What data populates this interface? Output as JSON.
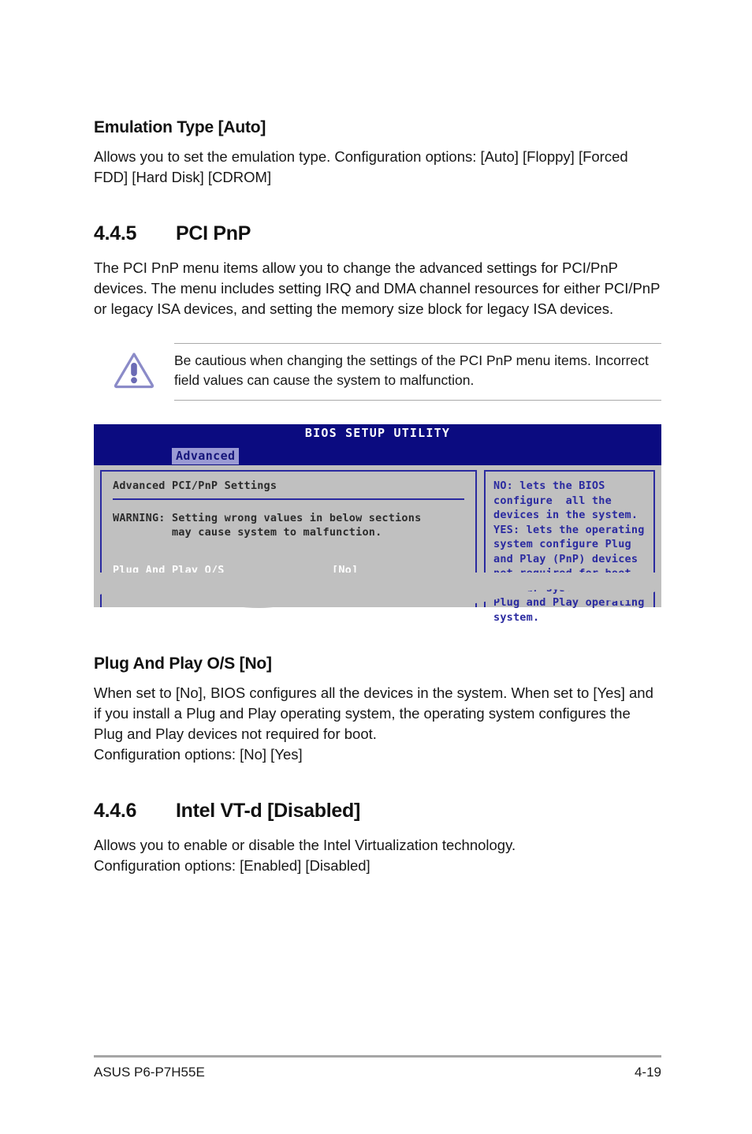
{
  "page": {
    "footer_left": "ASUS P6-P7H55E",
    "footer_right": "4-19"
  },
  "emulation": {
    "heading": "Emulation Type [Auto]",
    "body": "Allows you to set the emulation type. Configuration options: [Auto] [Floppy] [Forced FDD] [Hard Disk] [CDROM]"
  },
  "section_445": {
    "number": "4.4.5",
    "title": "PCI PnP",
    "body": "The PCI PnP menu items allow you to change the advanced settings for PCI/PnP devices. The menu includes setting IRQ and DMA channel resources for either PCI/PnP or legacy ISA devices, and setting the memory size block for legacy ISA devices."
  },
  "caution": {
    "icon": "warning-triangle-icon",
    "text": "Be cautious when changing the settings of the PCI PnP menu items. Incorrect field values can cause the system to malfunction."
  },
  "bios": {
    "title": "BIOS SETUP UTILITY",
    "active_tab": "Advanced",
    "left_panel": {
      "header": "Advanced PCI/PnP Settings",
      "warning_line1": "WARNING: Setting wrong values in below sections",
      "warning_line2": "         may cause system to malfunction.",
      "item_label": "Plug And Play O/S",
      "item_value": "[No]"
    },
    "help_panel": "NO: lets the BIOS\nconfigure  all the\ndevices in the system.\nYES: lets the operating\nsystem configure Plug\nand Play (PnP) devices\nnot required for boot\nif your system has a\nPlug and Play operating\nsystem.",
    "colors": {
      "titlebar": "#0b0b80",
      "panel_bg": "#c0c0c0",
      "border": "#2a2aa0",
      "tab_bg": "#9a9ad4",
      "help_text": "#2a2aa0"
    }
  },
  "pnp_os": {
    "heading": "Plug And Play O/S [No]",
    "body": "When set to [No], BIOS configures all the devices in the system. When set to [Yes] and if you install a Plug and Play operating system, the operating system configures the Plug and Play devices not required for boot.",
    "options": "Configuration options: [No] [Yes]"
  },
  "section_446": {
    "number": "4.4.6",
    "title": "Intel VT-d [Disabled]",
    "body": "Allows you to enable or disable the Intel Virtualization technology.",
    "options": "Configuration options: [Enabled] [Disabled]"
  }
}
